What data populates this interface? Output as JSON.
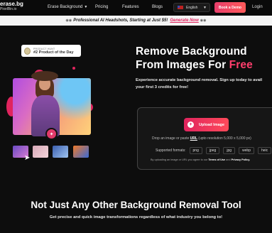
{
  "nav": {
    "logo_line1": "erase.bg",
    "logo_line2": "PixelBin.io",
    "items": [
      {
        "label": "Erase Background",
        "has_dropdown": true
      },
      {
        "label": "Pricing"
      },
      {
        "label": "Features"
      },
      {
        "label": "Blogs"
      }
    ],
    "language": "English",
    "demo_label": "Book a Demo",
    "login_label": "Login"
  },
  "promo": {
    "text": "Professional AI Headshots, Starting at Just $5!",
    "link": "Generate Now"
  },
  "hero": {
    "badge_top": "PRODUCT HUNT",
    "badge_main": "#2 Product of the Day",
    "title_line1": "Remove Background",
    "title_line2_a": "From Images For ",
    "title_line2_b": "Free",
    "subtitle_line1": "Experience accurate background removal. Sign up today to avail",
    "subtitle_line2": "your first 3 credits for free!"
  },
  "upload": {
    "button_label": "Upload Image",
    "drop_prefix": "Drop an image or paste ",
    "drop_url": "URL",
    "drop_suffix": " (upto resolution 5,000 x 5,000 px)",
    "formats_label": "Supported formats:",
    "formats": [
      "png",
      "jpeg",
      "jpg",
      "webp",
      "heic"
    ],
    "terms_prefix": "By uploading an image or URL you agree to our ",
    "terms_link": "Terms of Use",
    "terms_mid": " and ",
    "privacy_link": "Privacy Policy."
  },
  "section": {
    "title": "Not Just Any Other Background Removal Tool",
    "subtitle": "Get precise and quick image transformations regardless of what industry you belong to!"
  },
  "colors": {
    "accent": "#e0245e",
    "free_pink": "#ff3e6c"
  }
}
